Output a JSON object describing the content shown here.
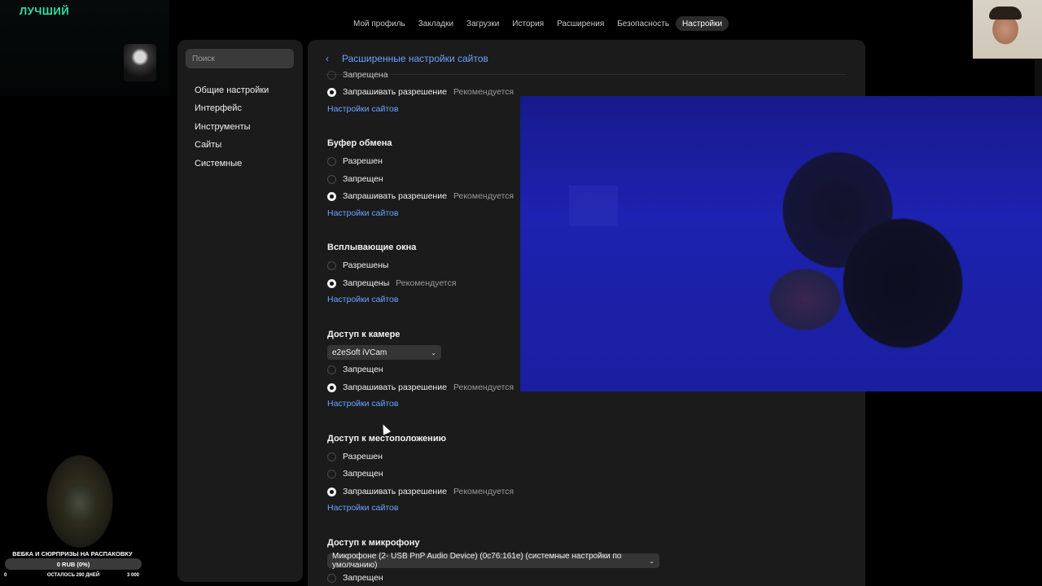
{
  "stream": {
    "logo": "ЛУЧШИЙ"
  },
  "topnav": {
    "tabs": [
      {
        "label": "Мой профиль"
      },
      {
        "label": "Закладки"
      },
      {
        "label": "Загрузки"
      },
      {
        "label": "История"
      },
      {
        "label": "Расширения"
      },
      {
        "label": "Безопасность"
      },
      {
        "label": "Настройки",
        "active": true
      }
    ]
  },
  "sidebar": {
    "search_placeholder": "Поиск",
    "items": [
      {
        "label": "Общие настройки"
      },
      {
        "label": "Интерфейс"
      },
      {
        "label": "Инструменты"
      },
      {
        "label": "Сайты"
      },
      {
        "label": "Системные"
      }
    ]
  },
  "main": {
    "title": "Расширенные настройки сайтов",
    "recommended": "Рекомендуется",
    "site_settings_link": "Настройки сайтов",
    "top_partial": {
      "options": [
        {
          "label": "Запрещена",
          "selected": false
        },
        {
          "label": "Запрашивать разрешение",
          "selected": true,
          "recommended": true
        }
      ]
    },
    "sections": [
      {
        "title": "Буфер обмена",
        "options": [
          {
            "label": "Разрешен",
            "selected": false
          },
          {
            "label": "Запрещен",
            "selected": false
          },
          {
            "label": "Запрашивать разрешение",
            "selected": true,
            "recommended": true
          }
        ]
      },
      {
        "title": "Всплывающие окна",
        "options": [
          {
            "label": "Разрешены",
            "selected": false
          },
          {
            "label": "Запрещены",
            "selected": true,
            "recommended": true
          }
        ]
      },
      {
        "title": "Доступ к камере",
        "dropdown": "e2eSoft iVCam",
        "options": [
          {
            "label": "Запрещен",
            "selected": false
          },
          {
            "label": "Запрашивать разрешение",
            "selected": true,
            "recommended": true
          }
        ]
      },
      {
        "title": "Доступ к местоположению",
        "options": [
          {
            "label": "Разрешен",
            "selected": false
          },
          {
            "label": "Запрещен",
            "selected": false
          },
          {
            "label": "Запрашивать разрешение",
            "selected": true,
            "recommended": true
          }
        ]
      },
      {
        "title": "Доступ к микрофону",
        "dropdown": "Микрофоне (2- USB PnP Audio Device) (0c76:161e) (системные настройки по умолчанию)",
        "options": [
          {
            "label": "Запрещен",
            "selected": false
          }
        ]
      }
    ]
  },
  "donation": {
    "title": "ВЕБКА И СЮРПРИЗЫ НА РАСПАКОВКУ",
    "amount": "0 RUB (0%)",
    "progress": 0,
    "min": "0",
    "days_left": "ОСТАЛОСЬ 290 ДНЕЙ",
    "max": "3 000"
  }
}
